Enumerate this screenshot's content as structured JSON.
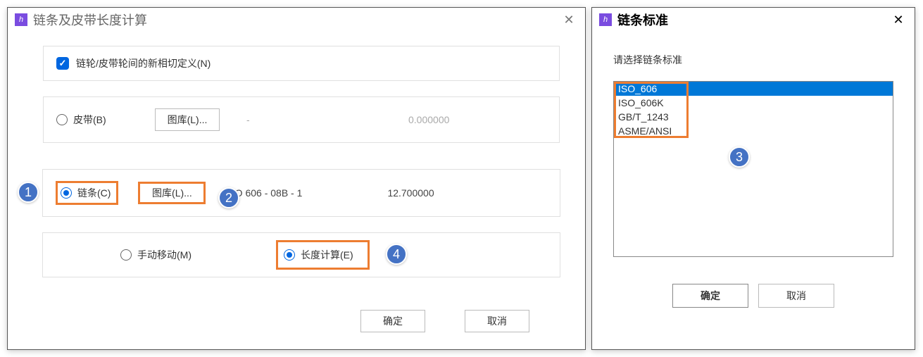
{
  "leftDialog": {
    "title": "链条及皮带长度计算",
    "checkbox_label": "链轮/皮带轮间的新相切定义(N)",
    "belt": {
      "radio_label": "皮带(B)",
      "button_label": "图库(L)...",
      "text": "-",
      "value": "0.000000"
    },
    "chain": {
      "radio_label": "链条(C)",
      "button_label": "图库(L)...",
      "text": "ISO 606 - 08B - 1",
      "value": "12.700000"
    },
    "move": {
      "manual_label": "手动移动(M)",
      "calc_label": "长度计算(E)"
    },
    "ok_label": "确定",
    "cancel_label": "取消"
  },
  "rightDialog": {
    "title": "链条标准",
    "prompt": "请选择链条标准",
    "items": [
      "ISO_606",
      "ISO_606K",
      "GB/T_1243",
      "ASME/ANSI"
    ],
    "selected_index": 0,
    "ok_label": "确定",
    "cancel_label": "取消"
  },
  "callouts": {
    "c1": "1",
    "c2": "2",
    "c3": "3",
    "c4": "4"
  }
}
